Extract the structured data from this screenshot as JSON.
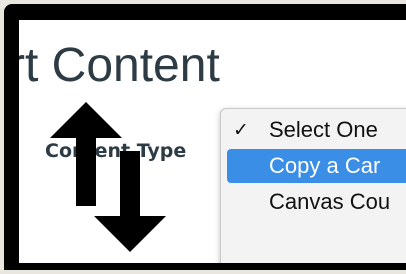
{
  "page": {
    "title": "rt Content",
    "field_label": "Content Type"
  },
  "dropdown": {
    "options": [
      {
        "label": "Select One",
        "checked": true,
        "highlighted": false
      },
      {
        "label": "Copy a Car",
        "checked": false,
        "highlighted": true
      },
      {
        "label": "Canvas Cou",
        "checked": false,
        "highlighted": false
      }
    ],
    "checkmark": "✓"
  },
  "annotations": {
    "arrow_up_icon": "arrow-up",
    "arrow_down_icon": "arrow-down"
  },
  "colors": {
    "title_text": "#2d3b45",
    "highlight": "#3a8ee6",
    "frame_bg": "#e9e6df",
    "screen_bg": "#000000"
  }
}
